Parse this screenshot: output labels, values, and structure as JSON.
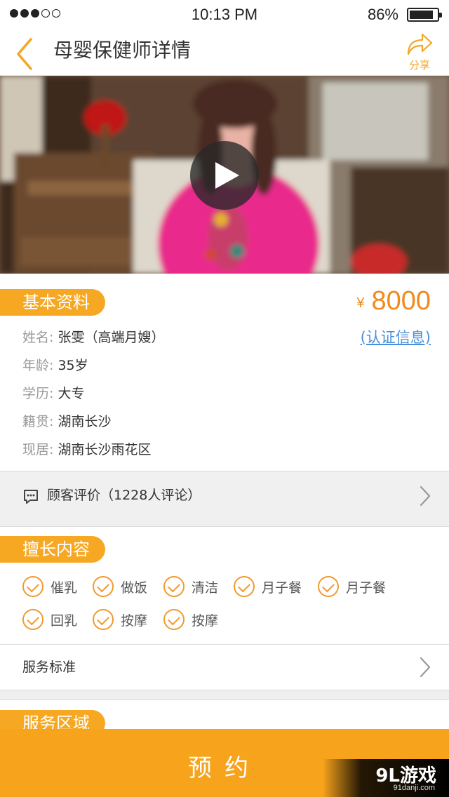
{
  "status_bar": {
    "signal": [
      true,
      true,
      true,
      false,
      false
    ],
    "time": "10:13 PM",
    "battery_text": "86%",
    "battery_level": 0.86
  },
  "nav": {
    "title": "母婴保健师详情",
    "back_icon": "chevron-left-icon",
    "share_icon": "share-arrow-icon",
    "share_label": "分享",
    "accent_color": "#f5a623"
  },
  "hero": {
    "play_icon": "play-icon"
  },
  "basic_info": {
    "section_title": "基本资料",
    "price_currency": "¥",
    "price": "8000",
    "cert_link": "(认证信息)",
    "rows": [
      {
        "label": "姓名:",
        "value": "张雯（高端月嫂）"
      },
      {
        "label": "年龄:",
        "value": "35岁"
      },
      {
        "label": "学历:",
        "value": "大专"
      },
      {
        "label": "籍贯:",
        "value": "湖南长沙"
      },
      {
        "label": "现居:",
        "value": "湖南长沙雨花区"
      }
    ]
  },
  "reviews": {
    "icon": "comment-icon",
    "label": "顾客评价（1228人评论）"
  },
  "skills": {
    "section_title": "擅长内容",
    "items": [
      "催乳",
      "做饭",
      "清洁",
      "月子餐",
      "月子餐",
      "回乳",
      "按摩",
      "按摩"
    ]
  },
  "service_standard": {
    "label": "服务标准"
  },
  "service_area": {
    "section_title": "服务区域"
  },
  "booking": {
    "label": "预约",
    "color": "#f7a31c"
  },
  "watermark": {
    "main": "9L游戏",
    "sub": "91danji.com"
  }
}
